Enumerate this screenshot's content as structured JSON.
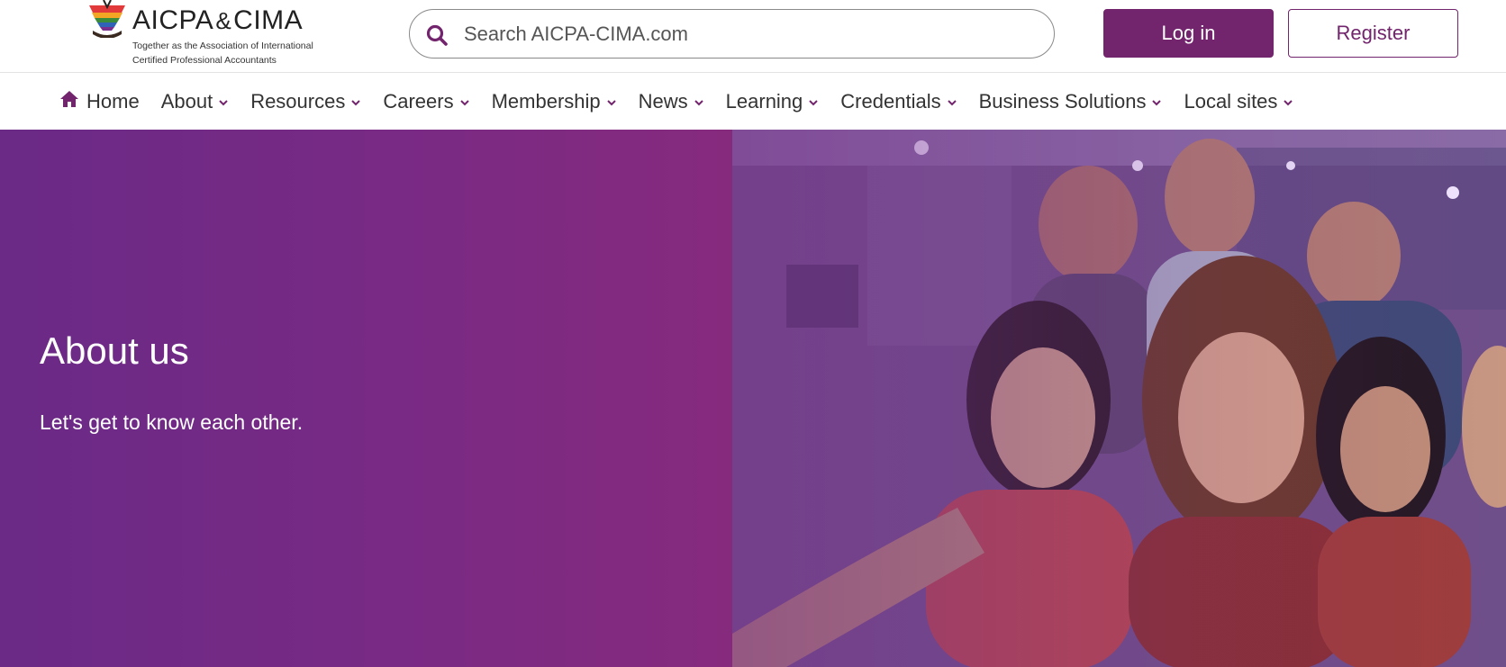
{
  "header": {
    "logo": {
      "wordmark_left": "AICPA",
      "wordmark_amp": "&",
      "wordmark_right": "CIMA",
      "tagline_line1": "Together as the Association of International",
      "tagline_line2": "Certified Professional Accountants"
    },
    "search": {
      "placeholder": "Search AICPA-CIMA.com",
      "value": "",
      "icon": "search-icon"
    },
    "login_label": "Log in",
    "register_label": "Register"
  },
  "nav": {
    "items": [
      {
        "label": "Home",
        "icon": "home-icon",
        "has_dropdown": false
      },
      {
        "label": "About",
        "has_dropdown": true
      },
      {
        "label": "Resources",
        "has_dropdown": true
      },
      {
        "label": "Careers",
        "has_dropdown": true
      },
      {
        "label": "Membership",
        "has_dropdown": true
      },
      {
        "label": "News",
        "has_dropdown": true
      },
      {
        "label": "Learning",
        "has_dropdown": true
      },
      {
        "label": "Credentials",
        "has_dropdown": true
      },
      {
        "label": "Business Solutions",
        "has_dropdown": true
      },
      {
        "label": "Local sites",
        "has_dropdown": true
      }
    ]
  },
  "hero": {
    "title": "About us",
    "subtitle": "Let's get to know each other."
  },
  "colors": {
    "brand_purple": "#72246c",
    "hero_purple": "#762a85",
    "nav_chevron": "#72246c"
  }
}
